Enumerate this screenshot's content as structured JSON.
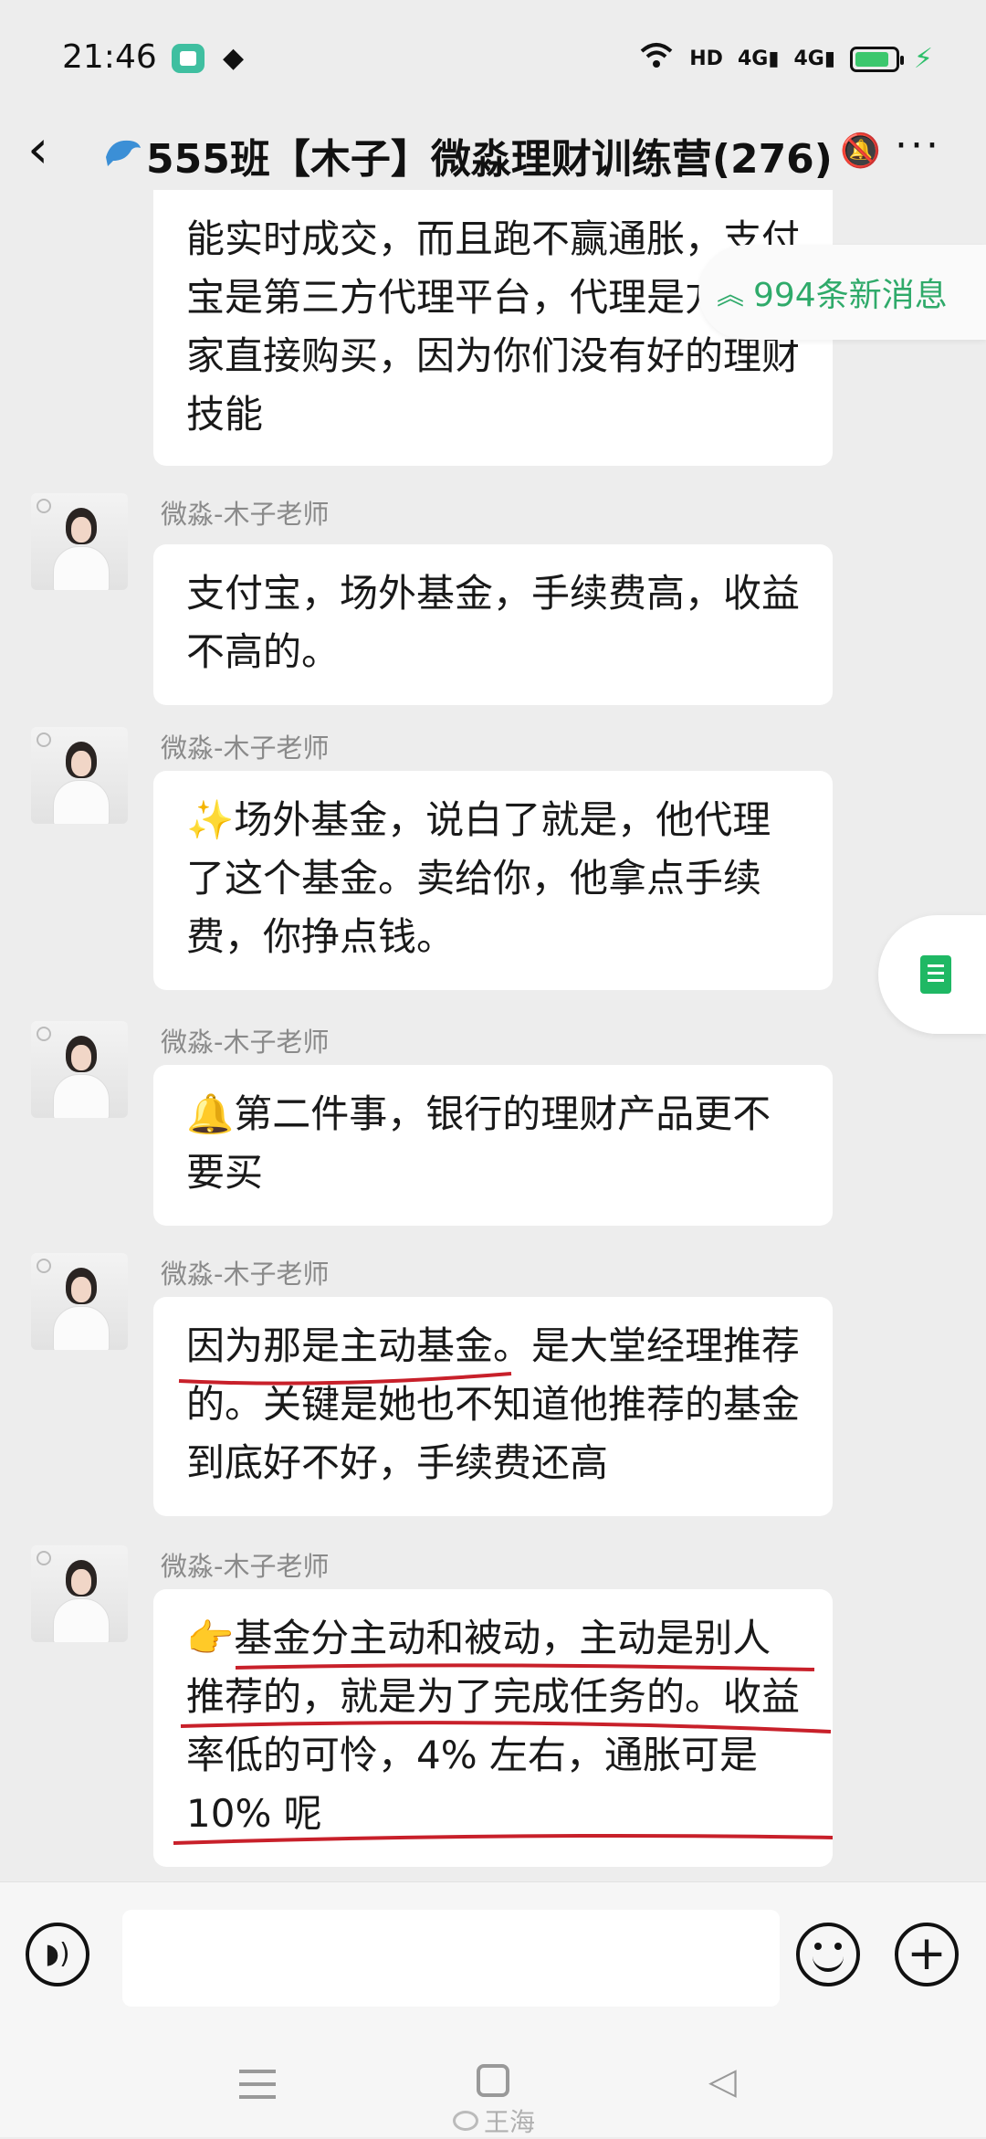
{
  "status_bar": {
    "time": "21:46",
    "net_label": "HD",
    "signal1": "4G",
    "signal2": "4G",
    "icons": [
      "app-icon",
      "layers-icon",
      "wifi-icon",
      "signal-icon",
      "battery-icon",
      "charging-icon"
    ]
  },
  "header": {
    "title": "555班【木子】微淼理财训练营(276)",
    "icons": [
      "back-icon",
      "dolphin-icon",
      "mute-icon",
      "more-icon"
    ]
  },
  "new_messages": {
    "label": "994条新消息"
  },
  "messages": [
    {
      "sender": "",
      "text": "能实时成交，而且跑不赢通胀，支付宝是第三方代理平台，代理是方便大家直接购买，因为你们没有好的理财技能"
    },
    {
      "sender": "微淼-木子老师",
      "text": "支付宝，场外基金，手续费高，收益不高的。"
    },
    {
      "sender": "微淼-木子老师",
      "emoji": "✨",
      "text": "场外基金，说白了就是，他代理了这个基金。卖给你，他拿点手续费，你挣点钱。"
    },
    {
      "sender": "微淼-木子老师",
      "emoji": "🔔",
      "text": "第二件事，银行的理财产品更不要买"
    },
    {
      "sender": "微淼-木子老师",
      "text": "因为那是主动基金。是大堂经理推荐的。关键是她也不知道他推荐的基金到底好不好，手续费还高"
    },
    {
      "sender": "微淼-木子老师",
      "emoji": "👉",
      "text": "基金分主动和被动，主动是别人推荐的，就是为了完成任务的。收益率低的可怜，4% 左右，通胀可是 10% 呢"
    }
  ],
  "input_bar": {
    "placeholder": "",
    "icons": [
      "voice-icon",
      "emoji-icon",
      "plus-icon"
    ]
  },
  "nav_bar": {
    "watermark": "王海",
    "icons": [
      "menu-icon",
      "home-icon",
      "back-nav-icon",
      "weibo-icon"
    ]
  },
  "colors": {
    "background": "#ededed",
    "accent_green": "#2faa6a",
    "annotation_red": "#c8202a"
  }
}
